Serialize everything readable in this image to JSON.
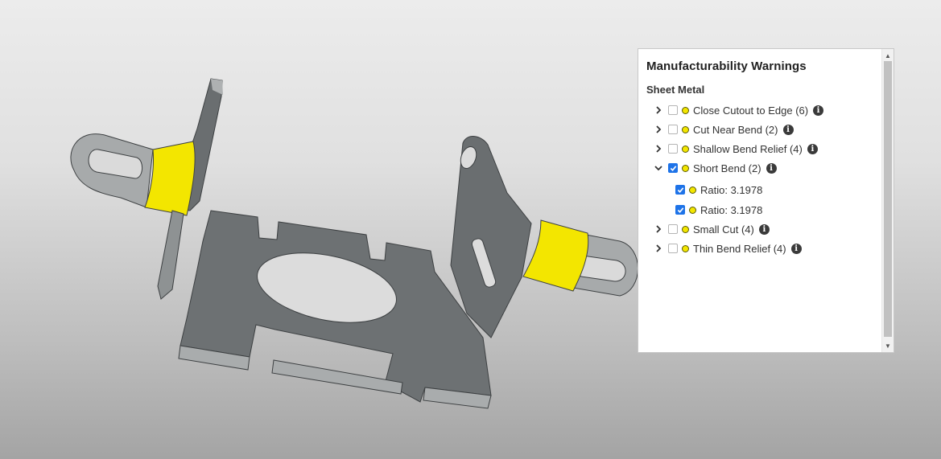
{
  "panel": {
    "title": "Manufacturability Warnings",
    "section": "Sheet Metal",
    "items": [
      {
        "label": "Close Cutout to Edge (6)",
        "checked": false,
        "expanded": false
      },
      {
        "label": "Cut Near Bend (2)",
        "checked": false,
        "expanded": false
      },
      {
        "label": "Shallow Bend Relief (4)",
        "checked": false,
        "expanded": false
      },
      {
        "label": "Short Bend (2)",
        "checked": true,
        "expanded": true,
        "children": [
          {
            "label": "Ratio: 3.1978",
            "checked": true
          },
          {
            "label": "Ratio: 3.1978",
            "checked": true
          }
        ]
      },
      {
        "label": "Small Cut (4)",
        "checked": false,
        "expanded": false
      },
      {
        "label": "Thin Bend Relief (4)",
        "checked": false,
        "expanded": false
      }
    ],
    "info_glyph": "i",
    "scroll_up_glyph": "▲",
    "scroll_down_glyph": "▼"
  },
  "colors": {
    "highlight": "#f3e600",
    "check_blue": "#1e73e8",
    "part_face": "#6d7173",
    "part_edge": "#a9acad"
  },
  "icons": [
    "chevron-right-icon",
    "chevron-down-icon",
    "checkbox-icon",
    "warning-dot-icon",
    "info-icon"
  ]
}
